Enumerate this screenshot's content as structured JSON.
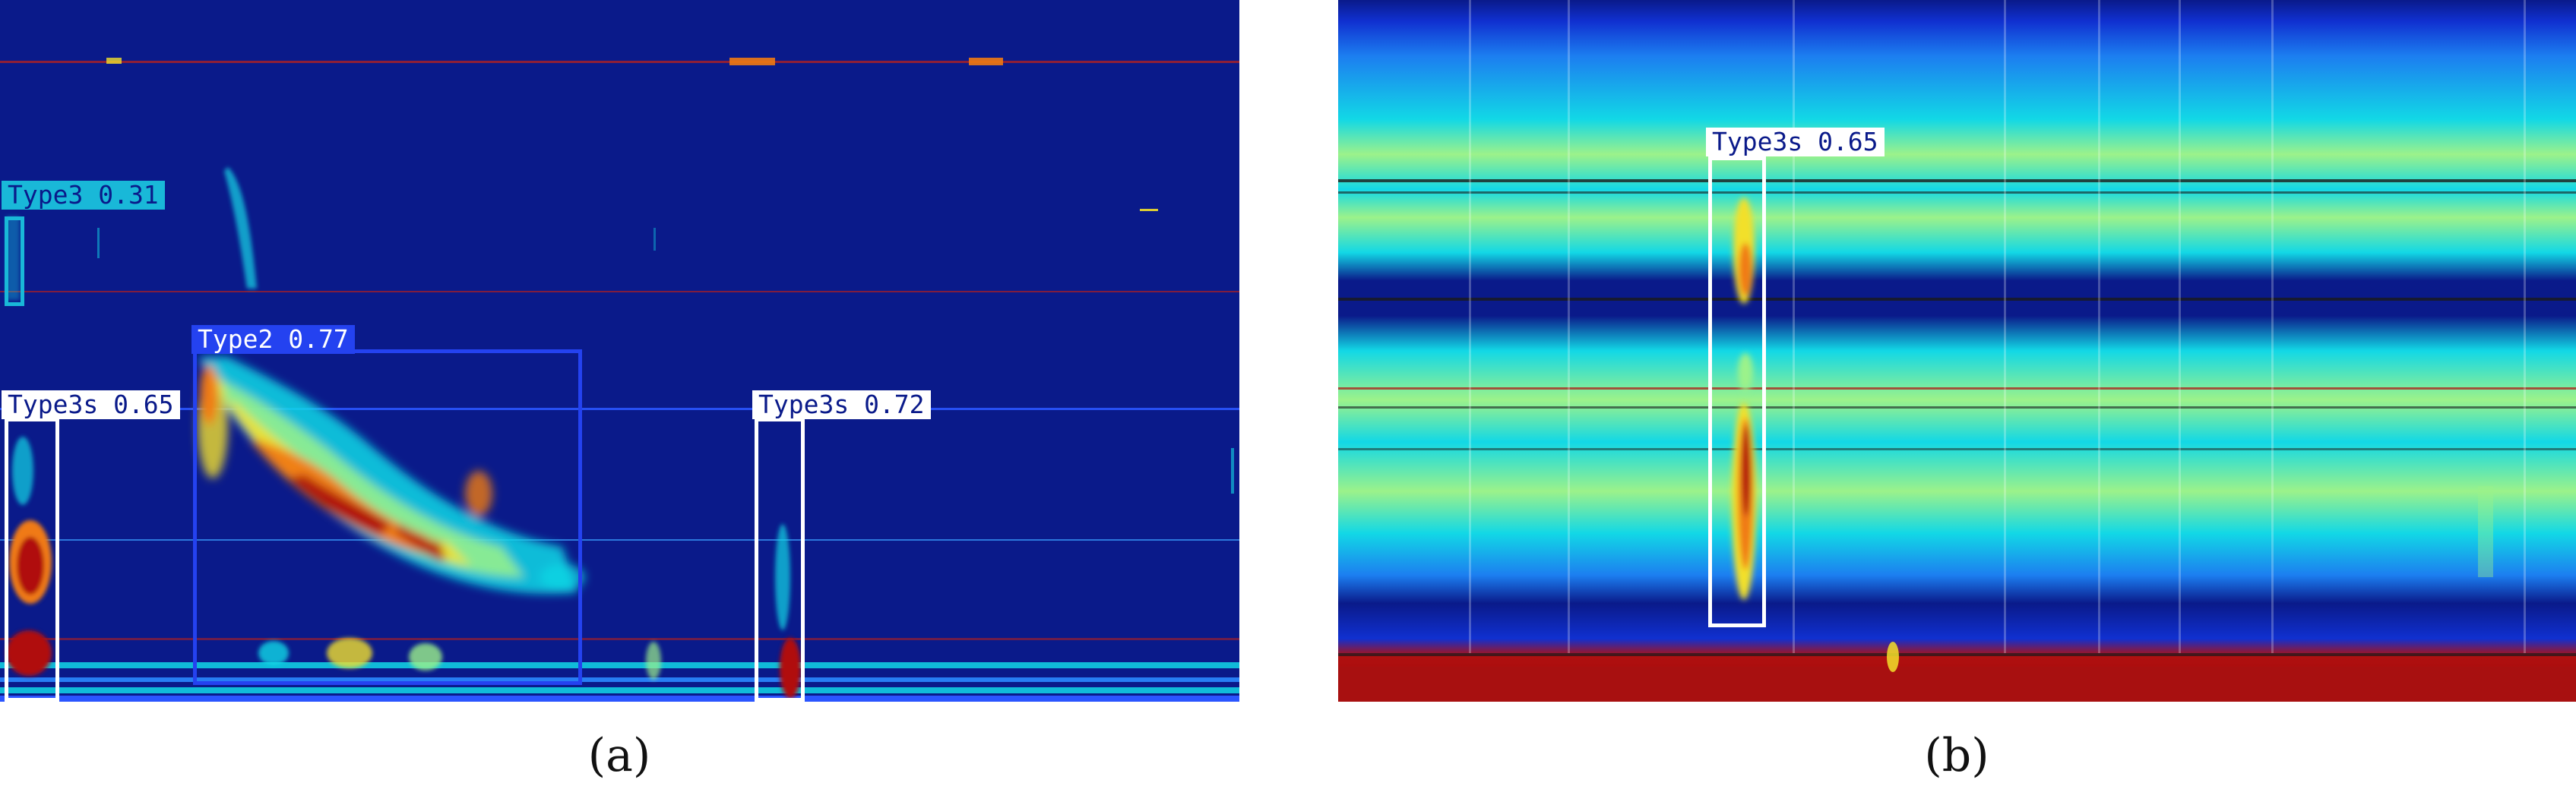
{
  "colors": {
    "background": "#0a1a8a",
    "cyan": "#12d8e6",
    "green": "#9cf28a",
    "yellow": "#f2e02a",
    "orange": "#f07a12",
    "red": "#b01010",
    "type3_box": "#19b8d8",
    "type2_box": "#2442f0",
    "type3s_box": "#ffffff"
  },
  "panels": [
    {
      "caption": "(a)",
      "detections": [
        {
          "label": "Type3 0.31",
          "class": "Type3",
          "confidence": 0.31,
          "color_key": "type3_box"
        },
        {
          "label": "Type2 0.77",
          "class": "Type2",
          "confidence": 0.77,
          "color_key": "type2_box"
        },
        {
          "label": "Type3s 0.65",
          "class": "Type3s",
          "confidence": 0.65,
          "color_key": "type3s_box"
        },
        {
          "label": "Type3s 0.72",
          "class": "Type3s",
          "confidence": 0.72,
          "color_key": "type3s_box"
        }
      ]
    },
    {
      "caption": "(b)",
      "detections": [
        {
          "label": "Type3s 0.65",
          "class": "Type3s",
          "confidence": 0.65,
          "color_key": "type3s_box"
        }
      ]
    }
  ]
}
